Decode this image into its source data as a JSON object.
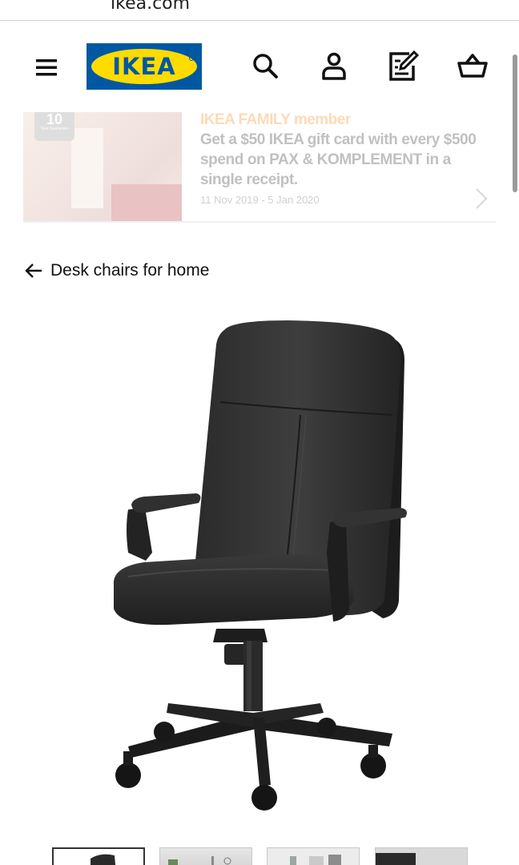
{
  "browser": {
    "url": "ikea.com"
  },
  "header": {
    "logo_text": "IKEA",
    "brand_blue": "#0058a3",
    "brand_yellow": "#ffdb00",
    "icons": [
      "menu-icon",
      "search-icon",
      "account-icon",
      "shopping-list-icon",
      "cart-icon"
    ]
  },
  "promo": {
    "badge_number": "10",
    "badge_text": "Year Guarantee",
    "heading": "IKEA FAMILY member",
    "body": "Get a $50 IKEA gift card with every $500 spend on PAX & KOMPLEMENT in a single receipt.",
    "dates": "11 Nov 2019 - 5 Jan 2020",
    "heading_color": "#ff7a00"
  },
  "breadcrumb": {
    "back_label": "Desk chairs for home"
  },
  "product": {
    "image": "black-office-chair"
  },
  "thumbnails": {
    "count": 4,
    "active_index": 0
  }
}
